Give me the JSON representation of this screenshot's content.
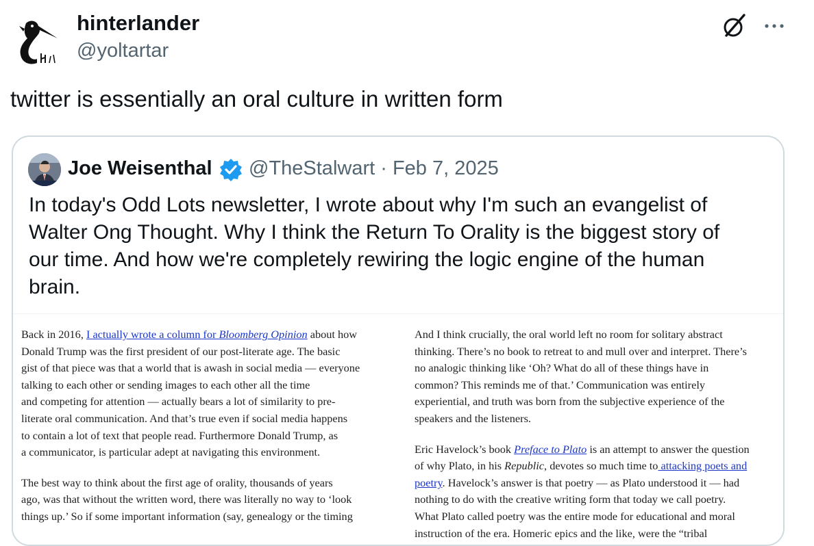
{
  "tweet": {
    "author_name": "hinterlander",
    "author_handle": "@yoltartar",
    "text": "twitter is essentially an oral culture in written form"
  },
  "icons": {
    "grok": "grok-slash-icon",
    "more": "more-horizontal-icon",
    "verified": "verified-badge-icon"
  },
  "colors": {
    "handle_gray": "#536471",
    "verified_blue": "#1d9bf0",
    "link_blue": "#1a35c7",
    "card_border": "#cfd9de"
  },
  "quote": {
    "author_name": "Joe Weisenthal",
    "author_handle": "@TheStalwart",
    "separator": "·",
    "date": "Feb 7, 2025",
    "text_lines": [
      "In today's Odd Lots newsletter, I wrote about why I'm such an evangelist of",
      "Walter Ong Thought. Why I think the Return To Orality is the biggest story of",
      "our time. And how we're completely rewiring the logic engine of the human",
      "brain."
    ]
  },
  "article": {
    "left": {
      "p1_lead": "Back in 2016, ",
      "p1_link_a": "I actually wrote a column for ",
      "p1_link_b": "Bloomberg Opinion",
      "p1_tail": " about how",
      "p1_lines": [
        "Donald Trump was the first president of our post-literate age. The basic",
        "gist of that piece was that a world that is awash in social media — everyone",
        "talking to each other or sending images to each other all the time",
        "and competing for attention — actually bears a lot of similarity to pre-",
        "literate oral communication. And that’s true even if social media happens",
        "to contain a lot of text that people read. Furthermore Donald Trump, as",
        "a communicator, is particular adept at navigating this environment."
      ],
      "p2_lines": [
        "The best way to think about the first age of orality, thousands of years",
        "ago, was that without the written word, there was literally no way to ‘look",
        "things up.’ So if some important information (say, genealogy or the timing"
      ]
    },
    "right": {
      "p1_lines": [
        "And I think crucially, the oral world left no room for solitary abstract",
        "thinking. There’s no book to retreat to and mull over and interpret. There’s",
        "no analogic thinking like ‘Oh? What do all of these things have in",
        "common? This reminds me of that.’ Communication was entirely",
        "experiential, and truth was born from the subjective experience of the",
        "speakers and the listeners."
      ],
      "p2_lead": "Eric Havelock’s book ",
      "p2_link1": "Preface to Plato",
      "p2_after_link1": " is an attempt to answer the question",
      "p2_l2_a": "of why Plato, in his ",
      "p2_l2_it": "Republic",
      "p2_l2_b": ", devotes so much time to",
      "p2_l2_link": " attacking poets and",
      "p2_l3_link": "poetry",
      "p2_l3_rest": ". Havelock’s answer is that poetry — as Plato understood it —  had",
      "p2_lines": [
        "nothing to do with the creative writing form that today we call poetry.",
        "What Plato called poetry was the entire mode for educational and moral",
        "instruction of the era. Homeric epics and the like, were the “tribal"
      ]
    }
  }
}
